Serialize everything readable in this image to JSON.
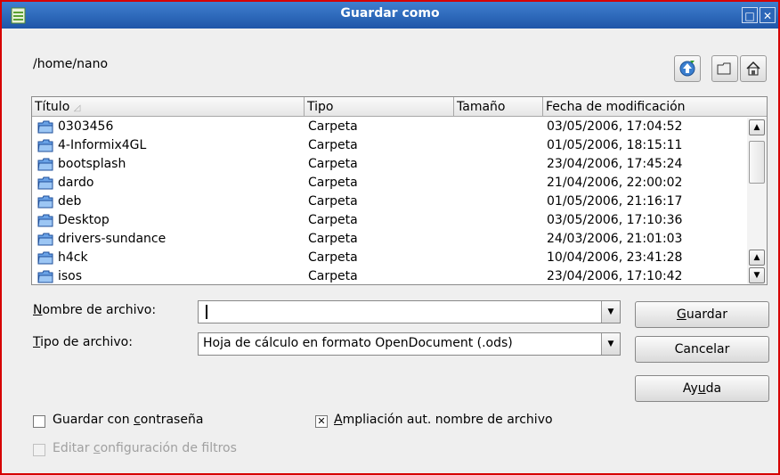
{
  "window": {
    "title": "Guardar como"
  },
  "toolbar": {
    "path": "/home/nano"
  },
  "columns": [
    "Título",
    "Tipo",
    "Tamaño",
    "Fecha de modificación"
  ],
  "files": [
    {
      "name": "0303456",
      "type": "Carpeta",
      "size": "",
      "date": "03/05/2006, 17:04:52"
    },
    {
      "name": "4-Informix4GL",
      "type": "Carpeta",
      "size": "",
      "date": "01/05/2006, 18:15:11"
    },
    {
      "name": "bootsplash",
      "type": "Carpeta",
      "size": "",
      "date": "23/04/2006, 17:45:24"
    },
    {
      "name": "dardo",
      "type": "Carpeta",
      "size": "",
      "date": "21/04/2006, 22:00:02"
    },
    {
      "name": "deb",
      "type": "Carpeta",
      "size": "",
      "date": "01/05/2006, 21:16:17"
    },
    {
      "name": "Desktop",
      "type": "Carpeta",
      "size": "",
      "date": "03/05/2006, 17:10:36"
    },
    {
      "name": "drivers-sundance",
      "type": "Carpeta",
      "size": "",
      "date": "24/03/2006, 21:01:03"
    },
    {
      "name": "h4ck",
      "type": "Carpeta",
      "size": "",
      "date": "10/04/2006, 23:41:28"
    },
    {
      "name": "isos",
      "type": "Carpeta",
      "size": "",
      "date": "23/04/2006, 17:10:42"
    }
  ],
  "form": {
    "filename_label_u": "N",
    "filename_label_rest": "ombre de archivo:",
    "filename_value": "",
    "filetype_label_u": "T",
    "filetype_label_rest": "ipo de archivo:",
    "filetype_value": "Hoja de cálculo en formato OpenDocument (.ods)"
  },
  "buttons": {
    "save_u": "G",
    "save_rest": "uardar",
    "cancel": "Cancelar",
    "help_pre": "Ay",
    "help_u": "u",
    "help_post": "da"
  },
  "options": {
    "password_pre": "Guardar con ",
    "password_u": "c",
    "password_post": "ontraseña",
    "password_checked": false,
    "autoext_u": "A",
    "autoext_rest": "mpliación aut. nombre de archivo",
    "autoext_checked": true,
    "filter_pre": "Editar ",
    "filter_u": "c",
    "filter_post": "onfiguración de filtros",
    "filter_enabled": false
  },
  "icons": [
    "app-icon",
    "maximize-icon",
    "close-icon",
    "up-folder-icon",
    "new-folder-icon",
    "home-icon",
    "folder-icon",
    "sort-arrow-icon",
    "scroll-up-icon",
    "scroll-down-icon",
    "dropdown-arrow-icon",
    "checkbox-checked-icon"
  ]
}
